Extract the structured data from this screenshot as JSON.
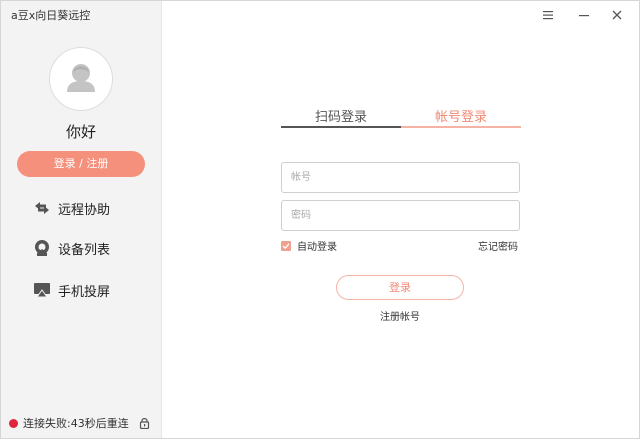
{
  "app": {
    "title": "a豆x向日葵远控"
  },
  "sidebar": {
    "greeting": "你好",
    "login_register_label": "登录 / 注册",
    "items": [
      {
        "label": "远程协助",
        "icon": "remote-assist-icon"
      },
      {
        "label": "设备列表",
        "icon": "device-list-icon"
      },
      {
        "label": "手机投屏",
        "icon": "screen-cast-icon"
      }
    ],
    "status": "连接失败:43秒后重连"
  },
  "login": {
    "tabs": [
      {
        "label": "扫码登录",
        "active": false
      },
      {
        "label": "帐号登录",
        "active": true
      }
    ],
    "account_placeholder": "帐号",
    "password_placeholder": "密码",
    "auto_login_label": "自动登录",
    "auto_login_checked": true,
    "forgot_label": "忘记密码",
    "login_button": "登录",
    "register_label": "注册帐号"
  },
  "colors": {
    "accent": "#f5907c",
    "accent_text": "#f08a76",
    "status_error": "#e0243b"
  }
}
